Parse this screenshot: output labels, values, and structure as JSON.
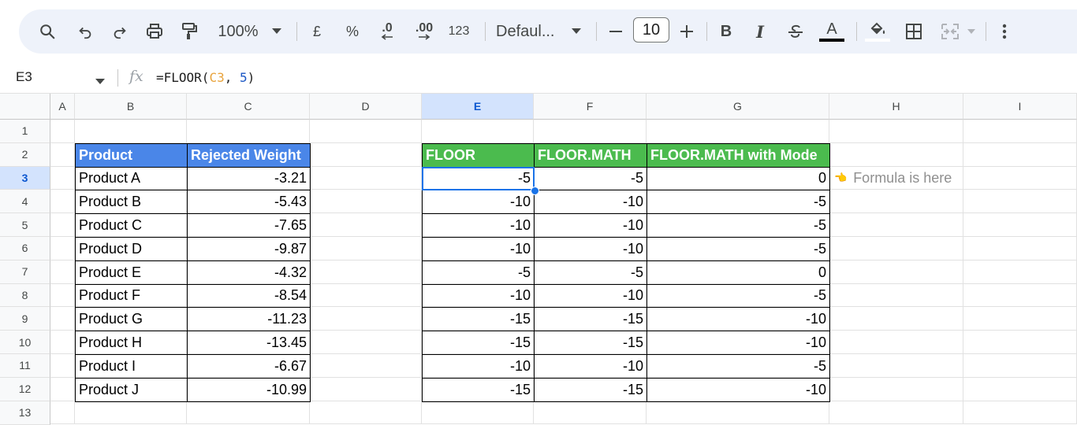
{
  "toolbar": {
    "zoom": "100%",
    "currency_label": "£",
    "percent_label": "%",
    "decrease_decimal_label": ".0",
    "increase_decimal_label": ".00",
    "number_format_label": "123",
    "font_family": "Defaul...",
    "font_size": "10",
    "bold_label": "B",
    "italic_label": "I",
    "text_color_label": "A"
  },
  "formula_bar": {
    "cell_ref": "E3",
    "fx_label": "fx",
    "formula_prefix": "=FLOOR(",
    "formula_ref": "C3",
    "formula_sep": ", ",
    "formula_num": "5",
    "formula_suffix": ")"
  },
  "columns": [
    "A",
    "B",
    "C",
    "D",
    "E",
    "F",
    "G",
    "H",
    "I"
  ],
  "rows": [
    "1",
    "2",
    "3",
    "4",
    "5",
    "6",
    "7",
    "8",
    "9",
    "10",
    "11",
    "12",
    "13"
  ],
  "selected_column": "E",
  "selected_row": "3",
  "table1": {
    "headers": [
      "Product",
      "Rejected Weight"
    ],
    "rows": [
      [
        "Product A",
        "-3.21"
      ],
      [
        "Product B",
        "-5.43"
      ],
      [
        "Product C",
        "-7.65"
      ],
      [
        "Product D",
        "-9.87"
      ],
      [
        "Product E",
        "-4.32"
      ],
      [
        "Product F",
        "-8.54"
      ],
      [
        "Product G",
        "-11.23"
      ],
      [
        "Product H",
        "-13.45"
      ],
      [
        "Product I",
        "-6.67"
      ],
      [
        "Product J",
        "-10.99"
      ]
    ]
  },
  "table2": {
    "headers": [
      "FLOOR",
      "FLOOR.MATH",
      "FLOOR.MATH with Mode"
    ],
    "rows": [
      [
        "-5",
        "-5",
        "0"
      ],
      [
        "-10",
        "-10",
        "-5"
      ],
      [
        "-10",
        "-10",
        "-5"
      ],
      [
        "-10",
        "-10",
        "-5"
      ],
      [
        "-5",
        "-5",
        "0"
      ],
      [
        "-10",
        "-10",
        "-5"
      ],
      [
        "-15",
        "-15",
        "-10"
      ],
      [
        "-15",
        "-15",
        "-10"
      ],
      [
        "-10",
        "-10",
        "-5"
      ],
      [
        "-15",
        "-15",
        "-10"
      ]
    ]
  },
  "note": {
    "icon": "pointing-hand-icon",
    "glyph": "👈",
    "text": "Formula is here"
  },
  "colors": {
    "header_blue": "#4a86e8",
    "header_green": "#4bbb4e",
    "selection": "#1a73e8"
  }
}
